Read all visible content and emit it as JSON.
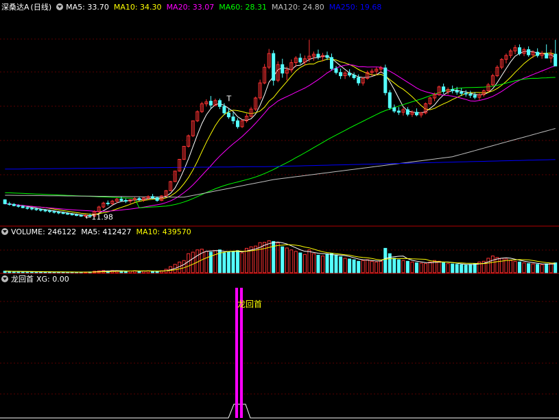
{
  "price_header": {
    "stock": "深桑达A",
    "period": "(日线)",
    "ma": [
      {
        "label": "MA5: 33.70",
        "color": "#ffffff"
      },
      {
        "label": "MA10: 34.30",
        "color": "#ffff00"
      },
      {
        "label": "MA20: 33.07",
        "color": "#ff00ff"
      },
      {
        "label": "MA60: 28.31",
        "color": "#00ff00"
      },
      {
        "label": "MA120: 24.80",
        "color": "#c0c0c0"
      },
      {
        "label": "MA250: 19.68",
        "color": "#0000ff"
      }
    ]
  },
  "volume_header": {
    "items": [
      {
        "label": "VOLUME: 246122",
        "color": "#ffffff"
      },
      {
        "label": "MA5: 412427",
        "color": "#ffffff"
      },
      {
        "label": "MA10: 439570",
        "color": "#ffff00"
      }
    ]
  },
  "indicator_header": {
    "name": "龙回首",
    "xg": "XG: 0.00"
  },
  "annotations": {
    "price_low": "11.98",
    "price_high_mark": "T",
    "signal_label": "龙回首"
  },
  "colors": {
    "up": "#ff3232",
    "down": "#54ffff",
    "panel_border": "#b40000",
    "signal": "#ff00ff",
    "signal_text": "#ffff00"
  },
  "chart_data": {
    "type": "candlestick",
    "price_range": [
      10,
      42
    ],
    "candles": [
      [
        13.5,
        13.6,
        12.8,
        12.9
      ],
      [
        12.9,
        13.2,
        12.6,
        12.8
      ],
      [
        12.8,
        13.0,
        12.5,
        12.6
      ],
      [
        12.6,
        12.8,
        12.3,
        12.5
      ],
      [
        12.5,
        12.7,
        12.2,
        12.3
      ],
      [
        12.3,
        12.5,
        12.0,
        12.2
      ],
      [
        12.2,
        12.4,
        11.9,
        12.1
      ],
      [
        12.1,
        12.3,
        11.8,
        12.0
      ],
      [
        12.0,
        12.2,
        11.7,
        11.9
      ],
      [
        11.9,
        12.1,
        11.6,
        11.8
      ],
      [
        11.8,
        12.0,
        11.5,
        11.7
      ],
      [
        11.7,
        11.9,
        11.4,
        11.6
      ],
      [
        11.6,
        11.8,
        11.3,
        11.5
      ],
      [
        11.5,
        11.7,
        11.3,
        11.4
      ],
      [
        11.4,
        11.6,
        11.2,
        11.3
      ],
      [
        11.3,
        11.5,
        11.1,
        11.2
      ],
      [
        11.2,
        11.4,
        11.0,
        11.1
      ],
      [
        11.1,
        11.3,
        10.9,
        11.0
      ],
      [
        11.0,
        11.3,
        10.9,
        11.1
      ],
      [
        11.1,
        11.4,
        10.9,
        11.0
      ],
      [
        11.0,
        11.9,
        10.8,
        11.7
      ],
      [
        11.7,
        12.6,
        11.5,
        12.4
      ],
      [
        12.4,
        13.2,
        12.2,
        13.0
      ],
      [
        13.0,
        13.4,
        12.6,
        12.9
      ],
      [
        12.9,
        13.5,
        12.7,
        13.3
      ],
      [
        13.3,
        13.8,
        13.0,
        13.6
      ],
      [
        13.6,
        14.0,
        13.2,
        13.4
      ],
      [
        13.4,
        13.7,
        13.0,
        13.3
      ],
      [
        13.3,
        13.6,
        12.9,
        13.5
      ],
      [
        13.5,
        13.9,
        13.2,
        13.7
      ],
      [
        13.7,
        14.0,
        13.3,
        13.5
      ],
      [
        13.5,
        13.9,
        13.2,
        13.8
      ],
      [
        13.8,
        14.2,
        13.5,
        14.0
      ],
      [
        14.0,
        14.4,
        13.6,
        13.8
      ],
      [
        13.8,
        14.0,
        13.2,
        13.4
      ],
      [
        13.4,
        14.2,
        13.3,
        14.1
      ],
      [
        14.1,
        15.0,
        14.0,
        14.9
      ],
      [
        14.9,
        16.4,
        14.8,
        16.3
      ],
      [
        16.3,
        17.9,
        16.2,
        17.9
      ],
      [
        17.9,
        19.7,
        17.8,
        19.7
      ],
      [
        19.7,
        21.7,
        19.6,
        21.7
      ],
      [
        21.7,
        23.5,
        21.5,
        23.3
      ],
      [
        23.3,
        25.6,
        23.1,
        25.6
      ],
      [
        25.6,
        27.2,
        25.4,
        27.0
      ],
      [
        27.0,
        28.5,
        26.8,
        28.2
      ],
      [
        28.2,
        28.9,
        27.8,
        28.5
      ],
      [
        28.6,
        29.4,
        27.5,
        28.0
      ],
      [
        28.0,
        29.0,
        27.8,
        28.7
      ],
      [
        28.7,
        29.0,
        27.4,
        27.8
      ],
      [
        27.8,
        28.3,
        26.5,
        26.8
      ],
      [
        26.8,
        27.5,
        25.9,
        26.2
      ],
      [
        26.2,
        26.9,
        25.1,
        25.6
      ],
      [
        25.6,
        26.0,
        24.4,
        24.7
      ],
      [
        24.7,
        25.8,
        24.5,
        25.6
      ],
      [
        25.6,
        26.7,
        25.3,
        26.3
      ],
      [
        26.3,
        27.7,
        26.1,
        27.4
      ],
      [
        27.4,
        29.3,
        27.1,
        29.1
      ],
      [
        29.1,
        31.9,
        28.8,
        31.4
      ],
      [
        31.4,
        34.3,
        31.2,
        33.8
      ],
      [
        33.8,
        36.6,
        33.5,
        35.9
      ],
      [
        35.9,
        36.4,
        31.0,
        31.8
      ],
      [
        31.8,
        34.7,
        31.5,
        34.2
      ],
      [
        34.2,
        35.1,
        32.2,
        32.9
      ],
      [
        32.9,
        33.9,
        31.8,
        33.4
      ],
      [
        33.4,
        35.0,
        33.0,
        34.5
      ],
      [
        34.5,
        35.5,
        33.8,
        35.2
      ],
      [
        35.2,
        35.9,
        34.3,
        34.6
      ],
      [
        34.6,
        35.6,
        34.1,
        35.1
      ],
      [
        35.1,
        38.0,
        34.6,
        35.5
      ],
      [
        35.5,
        36.2,
        34.8,
        35.8
      ],
      [
        35.8,
        36.5,
        35.0,
        35.4
      ],
      [
        35.4,
        36.0,
        34.7,
        35.6
      ],
      [
        35.6,
        36.2,
        34.9,
        35.3
      ],
      [
        35.3,
        35.9,
        33.3,
        33.6
      ],
      [
        33.6,
        34.0,
        32.7,
        33.0
      ],
      [
        33.0,
        33.6,
        32.0,
        32.5
      ],
      [
        32.5,
        33.2,
        32.0,
        32.9
      ],
      [
        32.9,
        33.5,
        32.3,
        32.6
      ],
      [
        32.6,
        33.0,
        31.9,
        32.2
      ],
      [
        32.2,
        32.7,
        31.0,
        31.4
      ],
      [
        31.4,
        32.3,
        31.0,
        32.1
      ],
      [
        32.1,
        33.3,
        31.9,
        33.0
      ],
      [
        33.0,
        33.6,
        32.4,
        33.2
      ],
      [
        33.2,
        33.8,
        32.6,
        33.5
      ],
      [
        33.5,
        34.0,
        32.9,
        33.7
      ],
      [
        33.7,
        34.2,
        29.5,
        29.9
      ],
      [
        29.9,
        30.3,
        27.3,
        27.6
      ],
      [
        27.6,
        28.1,
        26.8,
        27.1
      ],
      [
        27.1,
        27.7,
        26.5,
        26.9
      ],
      [
        26.9,
        27.6,
        26.4,
        27.3
      ],
      [
        27.3,
        27.7,
        26.3,
        26.6
      ],
      [
        26.6,
        27.2,
        26.2,
        26.9
      ],
      [
        26.9,
        27.5,
        26.3,
        26.5
      ],
      [
        26.5,
        27.0,
        26.1,
        26.8
      ],
      [
        26.8,
        28.4,
        26.6,
        28.2
      ],
      [
        28.2,
        29.3,
        28.0,
        29.1
      ],
      [
        29.1,
        29.9,
        28.6,
        29.6
      ],
      [
        29.6,
        31.0,
        29.4,
        30.8
      ],
      [
        30.8,
        31.3,
        29.7,
        30.1
      ],
      [
        30.1,
        30.7,
        29.6,
        30.4
      ],
      [
        30.4,
        31.0,
        29.8,
        30.2
      ],
      [
        30.2,
        30.8,
        29.6,
        30.0
      ],
      [
        30.0,
        30.6,
        29.4,
        29.8
      ],
      [
        29.8,
        30.3,
        29.3,
        29.7
      ],
      [
        29.7,
        30.2,
        29.1,
        29.5
      ],
      [
        29.5,
        30.0,
        28.9,
        29.2
      ],
      [
        29.2,
        29.8,
        28.8,
        29.6
      ],
      [
        29.6,
        30.4,
        29.3,
        30.2
      ],
      [
        30.2,
        31.4,
        30.0,
        31.1
      ],
      [
        31.1,
        32.8,
        30.9,
        32.5
      ],
      [
        32.5,
        34.1,
        32.3,
        33.8
      ],
      [
        33.8,
        35.2,
        33.5,
        35.0
      ],
      [
        35.0,
        35.9,
        34.4,
        35.6
      ],
      [
        35.6,
        36.6,
        35.2,
        36.3
      ],
      [
        36.3,
        37.2,
        35.8,
        36.8
      ],
      [
        36.8,
        37.3,
        35.6,
        35.9
      ],
      [
        35.9,
        36.8,
        35.5,
        36.5
      ],
      [
        36.5,
        37.0,
        35.4,
        35.7
      ],
      [
        35.7,
        36.4,
        35.2,
        36.1
      ],
      [
        36.1,
        36.7,
        35.3,
        35.6
      ],
      [
        35.6,
        36.3,
        35.1,
        35.9
      ],
      [
        35.9,
        37.3,
        35.5,
        35.2
      ],
      [
        35.2,
        36.5,
        34.5,
        35.8
      ],
      [
        35.8,
        38.0,
        35.3,
        34.0
      ]
    ],
    "ma_series": [
      {
        "name": "MA5",
        "color": "#ffffff"
      },
      {
        "name": "MA10",
        "color": "#ffff00"
      },
      {
        "name": "MA20",
        "color": "#ff00ff"
      },
      {
        "name": "MA60",
        "color": "#00ff00"
      },
      {
        "name": "MA120",
        "color": "#c0c0c0",
        "values_approx": [
          [
            0,
            14.2
          ],
          [
            40,
            13.9
          ],
          [
            60,
            16.6
          ],
          [
            100,
            20.1
          ],
          [
            125,
            24.8
          ]
        ]
      },
      {
        "name": "MA250",
        "color": "#0000ff",
        "values_approx": [
          [
            0,
            18.2
          ],
          [
            60,
            18.6
          ],
          [
            125,
            19.7
          ]
        ]
      }
    ],
    "volume_max": 900000,
    "volumes": [
      40000,
      35000,
      30000,
      30000,
      25000,
      25000,
      25000,
      22000,
      22000,
      20000,
      20000,
      18000,
      18000,
      16000,
      16000,
      15000,
      15000,
      15000,
      18000,
      20000,
      40000,
      50000,
      60000,
      45000,
      55000,
      50000,
      40000,
      38000,
      45000,
      50000,
      40000,
      45000,
      50000,
      40000,
      35000,
      50000,
      90000,
      160000,
      220000,
      280000,
      320000,
      500000,
      540000,
      600000,
      620000,
      560000,
      540000,
      580000,
      600000,
      520000,
      540000,
      560000,
      580000,
      520000,
      640000,
      680000,
      700000,
      790000,
      800000,
      840000,
      820000,
      780000,
      680000,
      650000,
      600000,
      560000,
      520000,
      480000,
      600000,
      500000,
      460000,
      440000,
      480000,
      500000,
      460000,
      420000,
      380000,
      360000,
      340000,
      300000,
      320000,
      340000,
      300000,
      280000,
      300000,
      640000,
      500000,
      380000,
      340000,
      320000,
      300000,
      280000,
      260000,
      250000,
      240000,
      280000,
      320000,
      300000,
      260000,
      240000,
      230000,
      220000,
      210000,
      200000,
      220000,
      240000,
      280000,
      300000,
      380000,
      440000,
      400000,
      380000,
      360000,
      320000,
      300000,
      280000,
      260000,
      240000,
      230000,
      220000,
      210000,
      230000,
      246122,
      260000
    ],
    "signal": {
      "label": "龙回首",
      "bars_at_index": [
        62,
        63
      ]
    }
  }
}
